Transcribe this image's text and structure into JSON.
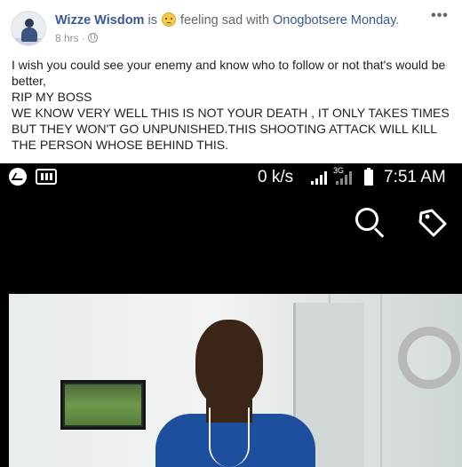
{
  "post": {
    "author": "Wizze Wisdom",
    "is_text": " is ",
    "feeling_text": " feeling sad with ",
    "tagged_name": "Onogbotsere Monday",
    "tagged_suffix": ".",
    "time": "8 hrs",
    "meta_separator": " · ",
    "icons": {
      "feeling": "sad-face-emoji",
      "audience": "globe-icon",
      "more": "more-options-icon"
    },
    "text_lines": [
      "I wish you could see your enemy and know who to follow or not that's would be",
      "better,",
      "RIP MY BOSS",
      "WE KNOW VERY WELL THIS IS NOT YOUR DEATH , IT ONLY TAKES TIMES",
      "BUT THEY WON'T GO UNPUNISHED.THIS SHOOTING ATTACK WILL KILL",
      "THE PERSON WHOSE BEHIND THIS."
    ]
  },
  "screenshot": {
    "network_speed": "0 k/s",
    "network_type": "3G",
    "time": "7:51 AM",
    "icons": [
      "messenger-icon",
      "gallery-icon",
      "signal-icon",
      "battery-icon",
      "search-icon",
      "tag-icon"
    ]
  }
}
